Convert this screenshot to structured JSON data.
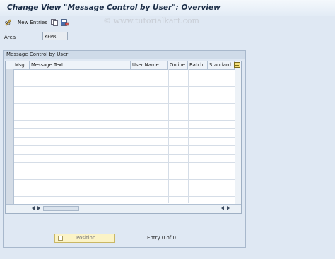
{
  "window": {
    "title": "Change View \"Message Control by User\": Overview"
  },
  "watermark": "© www.tutorialkart.com",
  "toolbar": {
    "new_entries_label": "New Entries",
    "icons": [
      "pencil-glasses-icon",
      "copy-icon",
      "save-icon"
    ]
  },
  "area": {
    "label": "Area",
    "value": "KFPR"
  },
  "group": {
    "title": "Message Control by User"
  },
  "table": {
    "columns": [
      "Msg...",
      "Message Text",
      "User Name",
      "Online",
      "BatchI",
      "Standard"
    ],
    "rows": []
  },
  "footer": {
    "position_label": "Position...",
    "entry_text": "Entry 0 of 0"
  }
}
